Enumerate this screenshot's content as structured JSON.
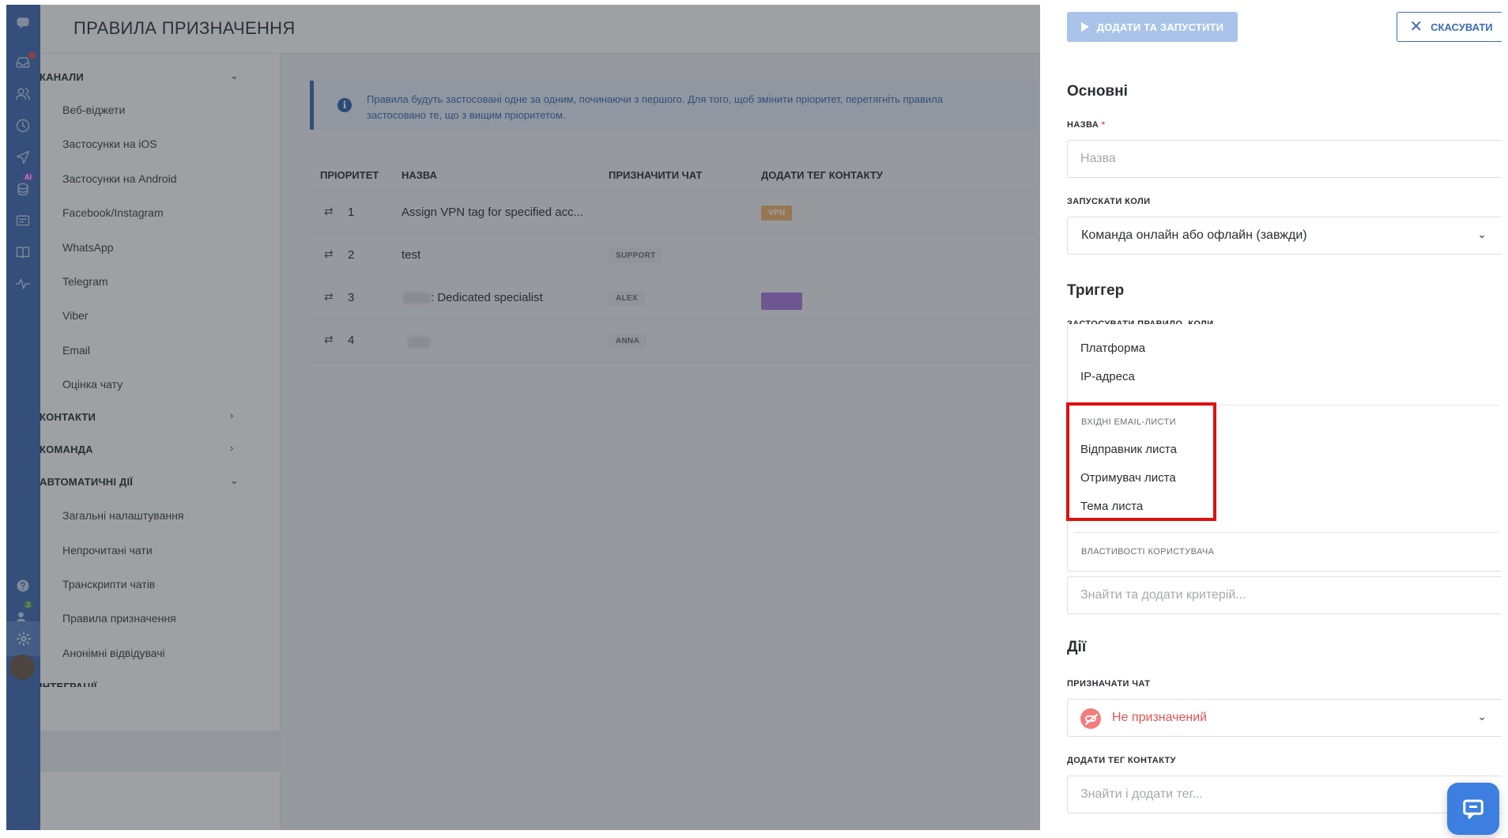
{
  "header": {
    "title": "ПРАВИЛА ПРИЗНАЧЕННЯ"
  },
  "nav": {
    "sections": {
      "channels": "КАНАЛИ",
      "contacts": "КОНТАКТИ",
      "team": "КОМАНДА",
      "automation": "АВТОМАТИЧНІ ДІЇ",
      "integrations": "ІНТЕГРАЦІЇ"
    },
    "channel_items": [
      "Веб-віджети",
      "Застосунки на iOS",
      "Застосунки на Android",
      "Facebook/Instagram",
      "WhatsApp",
      "Telegram",
      "Viber",
      "Email",
      "Оцінка чату"
    ],
    "automation_items": [
      "Загальні налаштування",
      "Непрочитані чати",
      "Транскрипти чатів",
      "Правила призначення",
      "Анонімні відвідувачі"
    ]
  },
  "info": {
    "icon": "info-icon",
    "line1": "Правила будуть застосовані одне за одним, починаючи з першого. Для того, щоб змінити пріоритет, перетягніть правила",
    "line2": "застосовано те, що з вищим пріоритетом."
  },
  "table": {
    "headers": {
      "priority": "ПРІОРИТЕТ",
      "name": "НАЗВА",
      "assign": "ПРИЗНАЧИТИ ЧАТ",
      "tag": "ДОДАТИ ТЕГ КОНТАКТУ"
    },
    "rows": [
      {
        "priority": "1",
        "name": "Assign VPN tag for specified acc...",
        "assign": "",
        "tag": "VPN"
      },
      {
        "priority": "2",
        "name": "test",
        "assign": "SUPPORT",
        "tag": ""
      },
      {
        "priority": "3",
        "name": ": Dedicated specialist",
        "assign": "ALEX",
        "tag": ""
      },
      {
        "priority": "4",
        "name": "",
        "assign": "ANNA",
        "tag": ""
      }
    ]
  },
  "panel": {
    "add_run_label": "ДОДАТИ ТА ЗАПУСТИТИ",
    "cancel_label": "СКАСУВАТИ",
    "basic_title": "Основні",
    "name_label": "НАЗВА",
    "name_required": "*",
    "name_placeholder": "Назва",
    "run_when_label": "ЗАПУСКАТИ КОЛИ",
    "run_when_value": "Команда онлайн або офлайн (завжди)",
    "trigger_title": "Триггер",
    "trigger_label": "ЗАСТОСУВАТИ ПРАВИЛО, КОЛИ",
    "dropdown": {
      "options_top": [
        "Платформа",
        "IP-адреса"
      ],
      "email_group": "ВХІДНІ EMAIL-ЛИСТИ",
      "email_options": [
        "Відправник листа",
        "Отримувач листа",
        "Тема листа"
      ],
      "user_props_group": "ВЛАСТИВОСТІ КОРИСТУВАЧА"
    },
    "criteria_placeholder": "Знайти та додати критерій...",
    "actions_title": "Дії",
    "assign_label": "ПРИЗНАЧАТИ ЧАТ",
    "assign_value": "Не призначений",
    "tag_label": "ДОДАТИ ТЕГ КОНТАКТУ",
    "tag_placeholder": "Знайти і додати тег..."
  },
  "rail": {
    "badge_count": "3",
    "ai_label": "AI"
  },
  "colors": {
    "accent": "#3c6cb4",
    "highlight": "#e0100d",
    "unassigned": "#f47c7c"
  }
}
